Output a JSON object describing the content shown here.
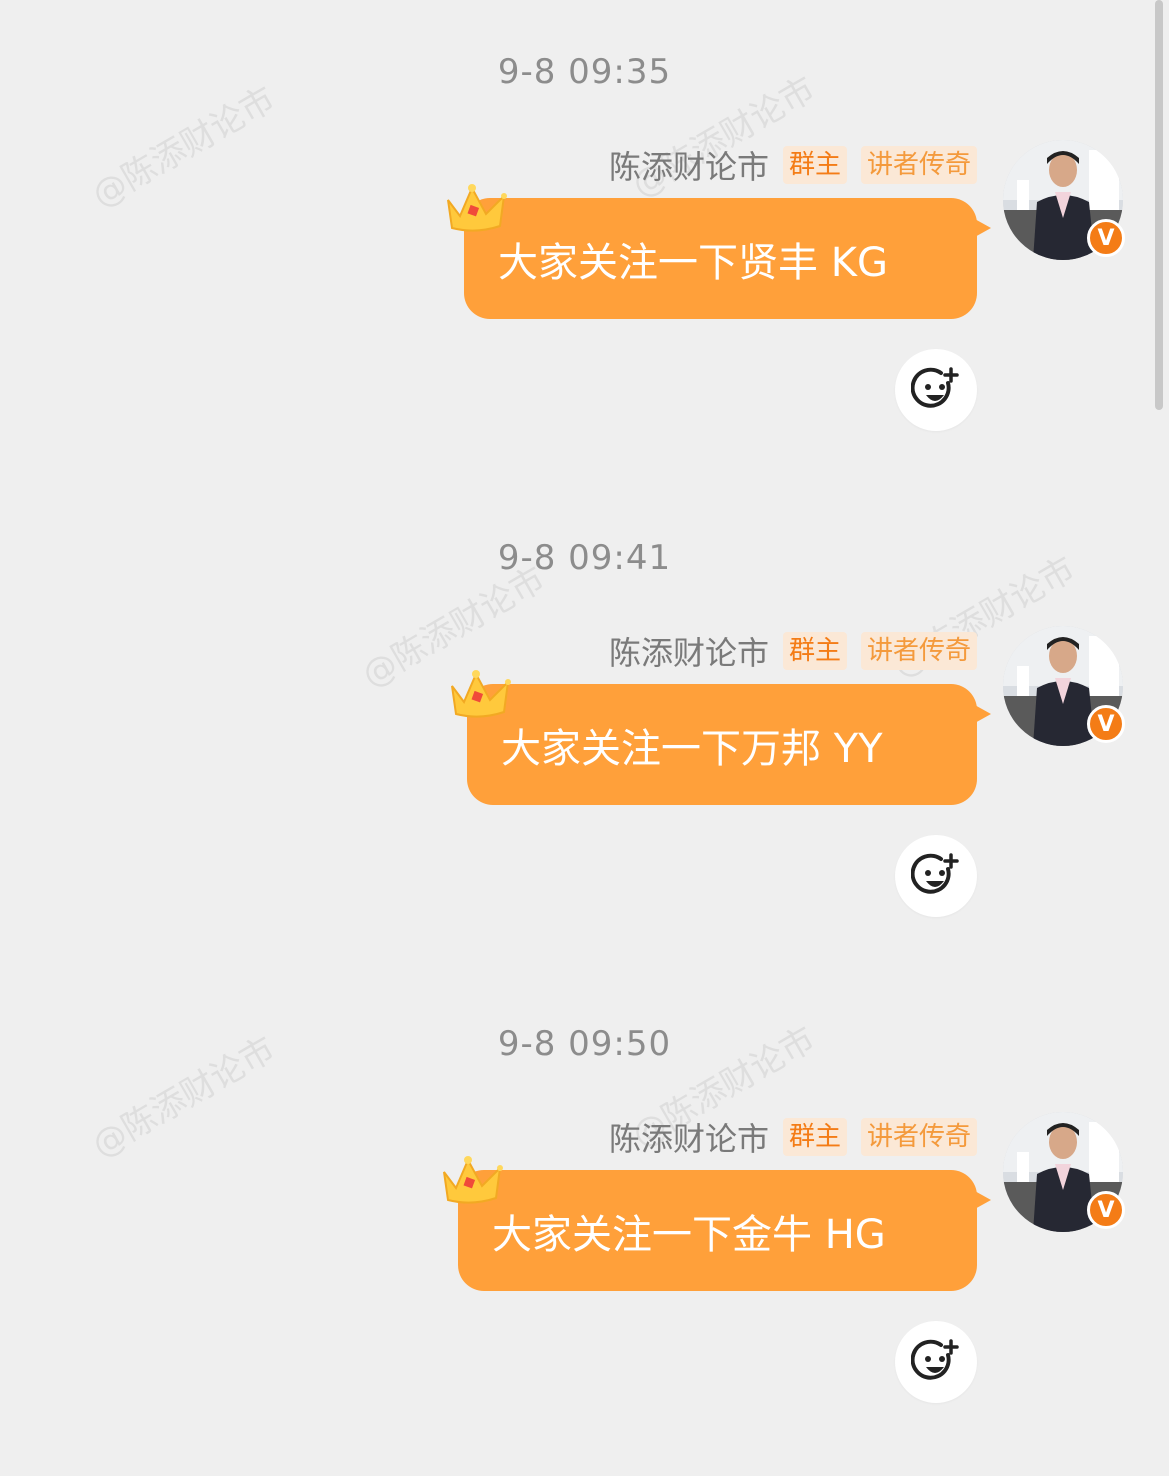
{
  "watermark": "@陈添财论市",
  "messages": [
    {
      "time": "9-8 09:35",
      "sender": "陈添财论市",
      "badge_owner": "群主",
      "badge_legend": "讲者传奇",
      "text": "大家关注一下贤丰 KG",
      "verified": "V"
    },
    {
      "time": "9-8 09:41",
      "sender": "陈添财论市",
      "badge_owner": "群主",
      "badge_legend": "讲者传奇",
      "text": "大家关注一下万邦 YY",
      "verified": "V"
    },
    {
      "time": "9-8 09:50",
      "sender": "陈添财论市",
      "badge_owner": "群主",
      "badge_legend": "讲者传奇",
      "text": "大家关注一下金牛 HG",
      "verified": "V"
    }
  ],
  "colors": {
    "bubble": "#ffa03a",
    "badge_text": "#f47c16",
    "badge_bg": "#fbe8d6",
    "background": "#efefef"
  },
  "icons": {
    "crown": "crown-icon",
    "react": "emoji-add-icon",
    "verified": "verified-v-icon"
  }
}
